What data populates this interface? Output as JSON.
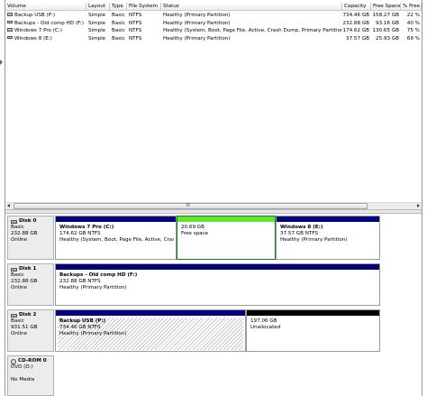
{
  "volume_table": {
    "columns": [
      "Volume",
      "Layout",
      "Type",
      "File System",
      "Status",
      "Capacity",
      "Free Space",
      "% Free"
    ],
    "rows": [
      {
        "volume": "Backup USB (P:)",
        "layout": "Simple",
        "type": "Basic",
        "fs": "NTFS",
        "status": "Healthy (Primary Partition)",
        "capacity": "734.46 GB",
        "free": "158.27 GB",
        "pct": "22 %"
      },
      {
        "volume": "Backups - Old comp HD (F:)",
        "layout": "Simple",
        "type": "Basic",
        "fs": "NTFS",
        "status": "Healthy (Primary Partition)",
        "capacity": "232.88 GB",
        "free": "93.16 GB",
        "pct": "40 %"
      },
      {
        "volume": "Windows 7 Pro (C:)",
        "layout": "Simple",
        "type": "Basic",
        "fs": "NTFS",
        "status": "Healthy (System, Boot, Page File, Active, Crash Dump, Primary Partition)",
        "capacity": "174.62 GB",
        "free": "130.65 GB",
        "pct": "75 %"
      },
      {
        "volume": "Windows 8 (E:)",
        "layout": "Simple",
        "type": "Basic",
        "fs": "NTFS",
        "status": "Healthy (Primary Partition)",
        "capacity": "37.57 GB",
        "free": "25.93 GB",
        "pct": "69 %"
      }
    ]
  },
  "colors": {
    "primary_partition": "#00007a",
    "free_space": "#5ee630",
    "unallocated": "#000000",
    "selected_border": "#177c16"
  },
  "disks": [
    {
      "name": "Disk 0",
      "type": "Basic",
      "size": "232.88 GB",
      "status": "Online",
      "partitions": [
        {
          "name": "Windows 7 Pro  (C:)",
          "size": "174.62 GB NTFS",
          "status": "Healthy (System, Boot, Page File, Active, Crash",
          "bar": "primary"
        },
        {
          "name": "",
          "size": "20.69 GB",
          "status": "Free space",
          "bar": "free"
        },
        {
          "name": "Windows 8  (E:)",
          "size": "37.57 GB NTFS",
          "status": "Healthy (Primary Partition)",
          "bar": "primary"
        }
      ]
    },
    {
      "name": "Disk 1",
      "type": "Basic",
      "size": "232.88 GB",
      "status": "Online",
      "partitions": [
        {
          "name": "Backups - Old comp HD  (F:)",
          "size": "232.88 GB NTFS",
          "status": "Healthy (Primary Partition)",
          "bar": "primary"
        }
      ]
    },
    {
      "name": "Disk 2",
      "type": "Basic",
      "size": "931.51 GB",
      "status": "Online",
      "partitions": [
        {
          "name": "Backup USB  (P:)",
          "size": "734.46 GB NTFS",
          "status": "Healthy (Primary Partition)",
          "bar": "primary"
        },
        {
          "name": "",
          "size": "197.06 GB",
          "status": "Unallocated",
          "bar": "unallocated"
        }
      ]
    },
    {
      "name": "CD-ROM 0",
      "type": "DVD (D:)",
      "size": "",
      "status": "No Media",
      "partitions": []
    }
  ]
}
